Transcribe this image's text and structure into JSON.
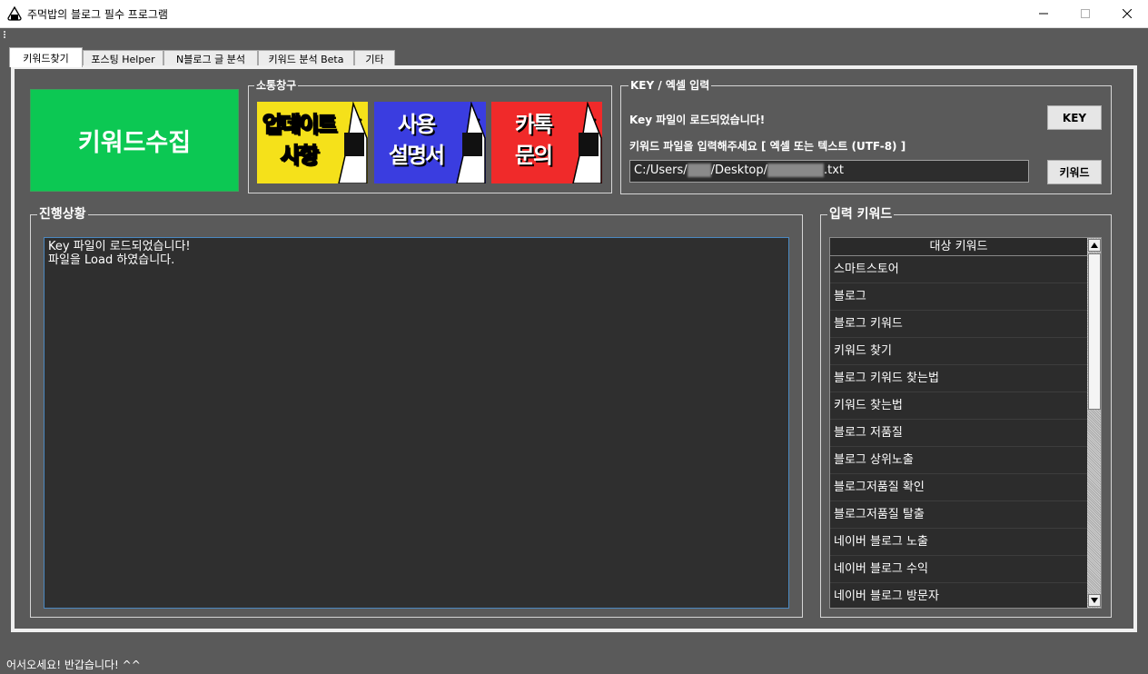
{
  "window": {
    "title": "주먹밥의 블로그 필수 프로그램",
    "icon": "onigiri-icon",
    "controls": [
      "minimize-icon",
      "maximize-icon",
      "close-icon"
    ]
  },
  "tabs": [
    {
      "label": "키워드찾기",
      "active": true
    },
    {
      "label": "포스팅 Helper",
      "active": false
    },
    {
      "label": "N블로그 글 분석",
      "active": false
    },
    {
      "label": "키워드 분석 Beta",
      "active": false
    },
    {
      "label": "기타",
      "active": false
    }
  ],
  "collect_button": {
    "label": "키워드수집",
    "color": "#0cc853"
  },
  "communication": {
    "title": "소통창구",
    "banners": [
      {
        "label_line1": "업데이트",
        "label_line2": "사항",
        "color": "#f5e11a"
      },
      {
        "label_line1": "사용",
        "label_line2": "설명서",
        "color": "#3a3de0"
      },
      {
        "label_line1": "카톡",
        "label_line2": "문의",
        "color": "#f02a2a"
      }
    ]
  },
  "key_panel": {
    "title": "KEY / 엑셀 입력",
    "key_status": "Key 파일이 로드되었습니다!",
    "file_prompt": "키워드 파일을 입력해주세요  [ 엑셀 또는 텍스트 (UTF-8) ]",
    "key_button": "KEY",
    "keyword_button": "키워드",
    "path_prefix": "C:/Users/",
    "path_middle": "/Desktop/",
    "path_suffix": ".txt"
  },
  "progress": {
    "title": "진행상황",
    "log": [
      "Key 파일이 로드되었습니다!",
      "파일을 Load 하였습니다."
    ]
  },
  "input_keywords": {
    "title": "입력 키워드",
    "header": "대상 키워드",
    "items": [
      "스마트스토어",
      "블로그",
      "블로그 키워드",
      "키워드 찾기",
      "블로그 키워드 찾는법",
      "키워드 찾는법",
      "블로그 저품질",
      "블로그 상위노출",
      "블로그저품질 확인",
      "블로그저품질 탈출",
      "네이버 블로그 노출",
      "네이버 블로그 수익",
      "네이버 블로그 방문자"
    ]
  },
  "status": "어서오세요! 반갑습니다! ^^"
}
